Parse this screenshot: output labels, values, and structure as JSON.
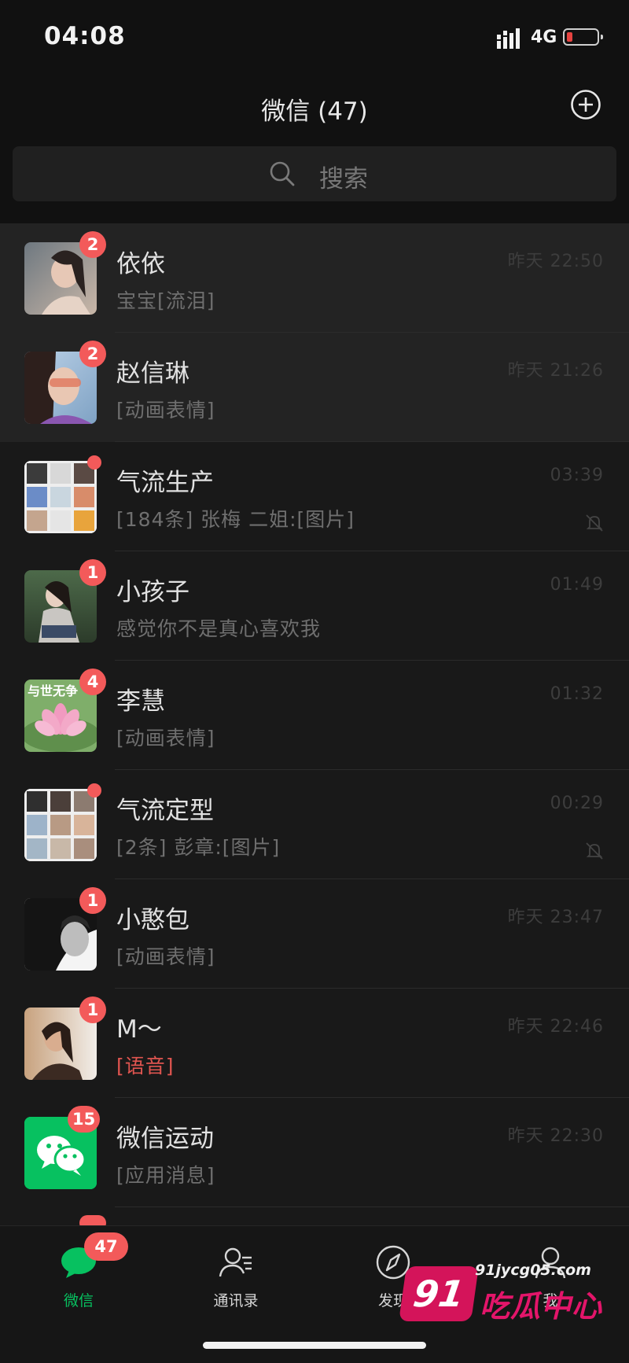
{
  "status": {
    "time": "04:08",
    "network": "4G"
  },
  "header": {
    "title": "微信 (47)"
  },
  "search": {
    "placeholder": "搜索"
  },
  "chats": [
    {
      "name": "依依",
      "message": "宝宝[流泪]",
      "time": "昨天 22:50",
      "badge": "2",
      "pinned": true
    },
    {
      "name": "赵信琳",
      "message": "[动画表情]",
      "time": "昨天 21:26",
      "badge": "2",
      "pinned": true
    },
    {
      "name": "气流生产",
      "message": "[184条] 张梅 二姐:[图片]",
      "time": "03:39",
      "muted": true
    },
    {
      "name": "小孩子",
      "message": "感觉你不是真心喜欢我",
      "time": "01:49",
      "badge": "1"
    },
    {
      "name": "李慧",
      "message": "[动画表情]",
      "time": "01:32",
      "badge": "4",
      "avatar_text": "与世无争"
    },
    {
      "name": "气流定型",
      "message": "[2条] 彭章:[图片]",
      "time": "00:29",
      "muted": true
    },
    {
      "name": "小憨包",
      "message": "[动画表情]",
      "time": "昨天 23:47",
      "badge": "1"
    },
    {
      "name": "M～",
      "message": "[语音]",
      "time": "昨天 22:46",
      "badge": "1",
      "message_color": "red"
    },
    {
      "name": "微信运动",
      "message": "[应用消息]",
      "time": "昨天 22:30",
      "badge": "15"
    }
  ],
  "tabs": [
    {
      "label": "微信",
      "badge": "47",
      "active": true,
      "icon": "chat-bubble-icon"
    },
    {
      "label": "通讯录",
      "icon": "contacts-icon"
    },
    {
      "label": "发现",
      "icon": "compass-icon"
    },
    {
      "label": "我",
      "icon": "person-icon"
    }
  ],
  "watermark": {
    "brand": "91",
    "url": "91jycg05.com",
    "name": "吃瓜中心"
  },
  "colors": {
    "background": "#191919",
    "accent": "#07c160",
    "badge": "#f35a5a",
    "pinned_row": "#232323"
  }
}
